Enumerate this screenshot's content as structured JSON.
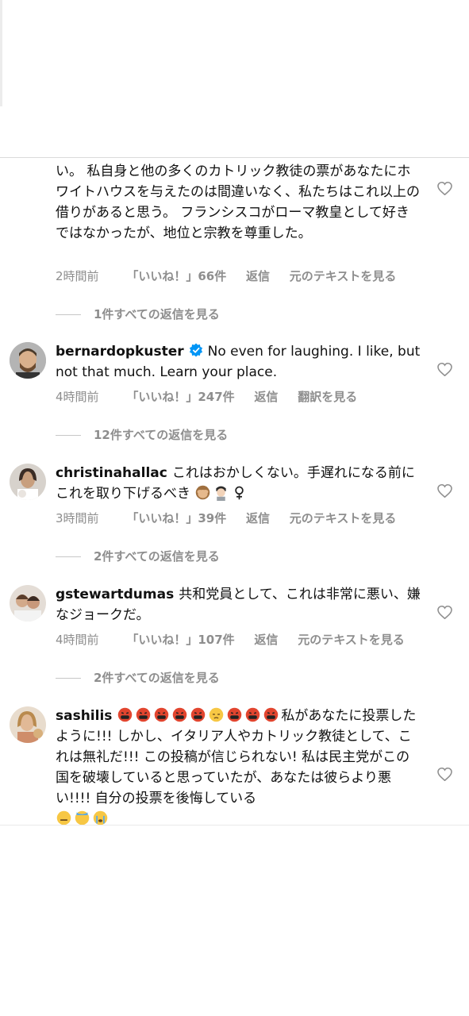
{
  "comments": [
    {
      "id": "c0",
      "text": "い。 私自身と他の多くのカトリック教徒の票があなたにホワイトハウスを与えたのは間違いなく、私たちはこれ以上の借りがあると思う。 フランシスコがローマ教皇として好きではなかったが、地位と宗教を尊重した。",
      "time": "2時間前",
      "likes": "「いいね！」66件",
      "reply": "返信",
      "translate": "元のテキストを見る",
      "view_replies": "1件すべての返信を見る"
    },
    {
      "id": "c1",
      "username": "bernardopkuster",
      "text": "No even for laughing. I like, but not that much. Learn your place.",
      "time": "4時間前",
      "likes": "「いいね！」247件",
      "reply": "返信",
      "translate": "翻訳を見る",
      "view_replies": "12件すべての返信を見る"
    },
    {
      "id": "c2",
      "username": "christinahallac",
      "text": "これはおかしくない。手遅れになる前にこれを取り下げるべき",
      "emoji_suffix": "🙈🤦🏻‍♀️",
      "time": "3時間前",
      "likes": "「いいね！」39件",
      "reply": "返信",
      "translate": "元のテキストを見る",
      "view_replies": "2件すべての返信を見る"
    },
    {
      "id": "c3",
      "username": "gstewartdumas",
      "text": "共和党員として、これは非常に悪い、嫌なジョークだ。",
      "time": "4時間前",
      "likes": "「いいね！」107件",
      "reply": "返信",
      "translate": "元のテキストを見る",
      "view_replies": "2件すべての返信を見る"
    },
    {
      "id": "c4",
      "username": "sashilis",
      "text_a": "私があなたに投票したように!!! しかし、イタリア人やカトリック教徒として、これは無礼だ!!! この投稿が信じられない! 私は民主党がこの国を破壊していると思っていたが、あなたは彼らより悪い!!!! 自分の投票を後悔している"
    }
  ],
  "icons": {
    "heart": "heart-outline-icon",
    "verified": "verified-badge-icon"
  },
  "colors": {
    "secondary_text": "#8e8e8e",
    "verified_blue": "#0095f6"
  }
}
